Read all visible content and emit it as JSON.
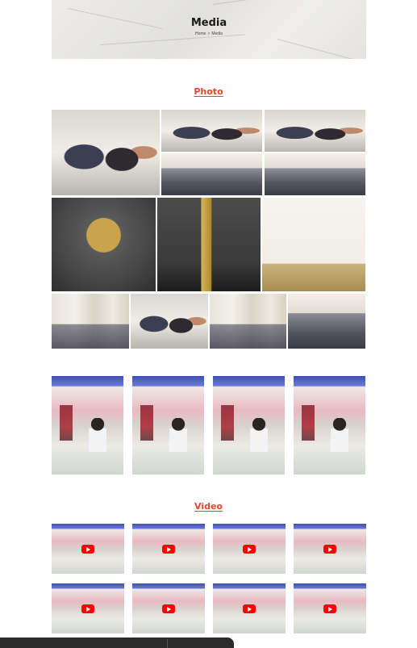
{
  "hero": {
    "title": "Media",
    "breadcrumb": {
      "home": "Home",
      "separator": ">",
      "current": "Media"
    }
  },
  "photo_section": {
    "title": "Photo"
  },
  "video_section": {
    "title": "Video"
  },
  "colors": {
    "accent": "#e8452c",
    "play_button": "#ff0000",
    "bottom_bar": "#2b2b2b"
  },
  "icons": {
    "play": "youtube-play-icon"
  }
}
